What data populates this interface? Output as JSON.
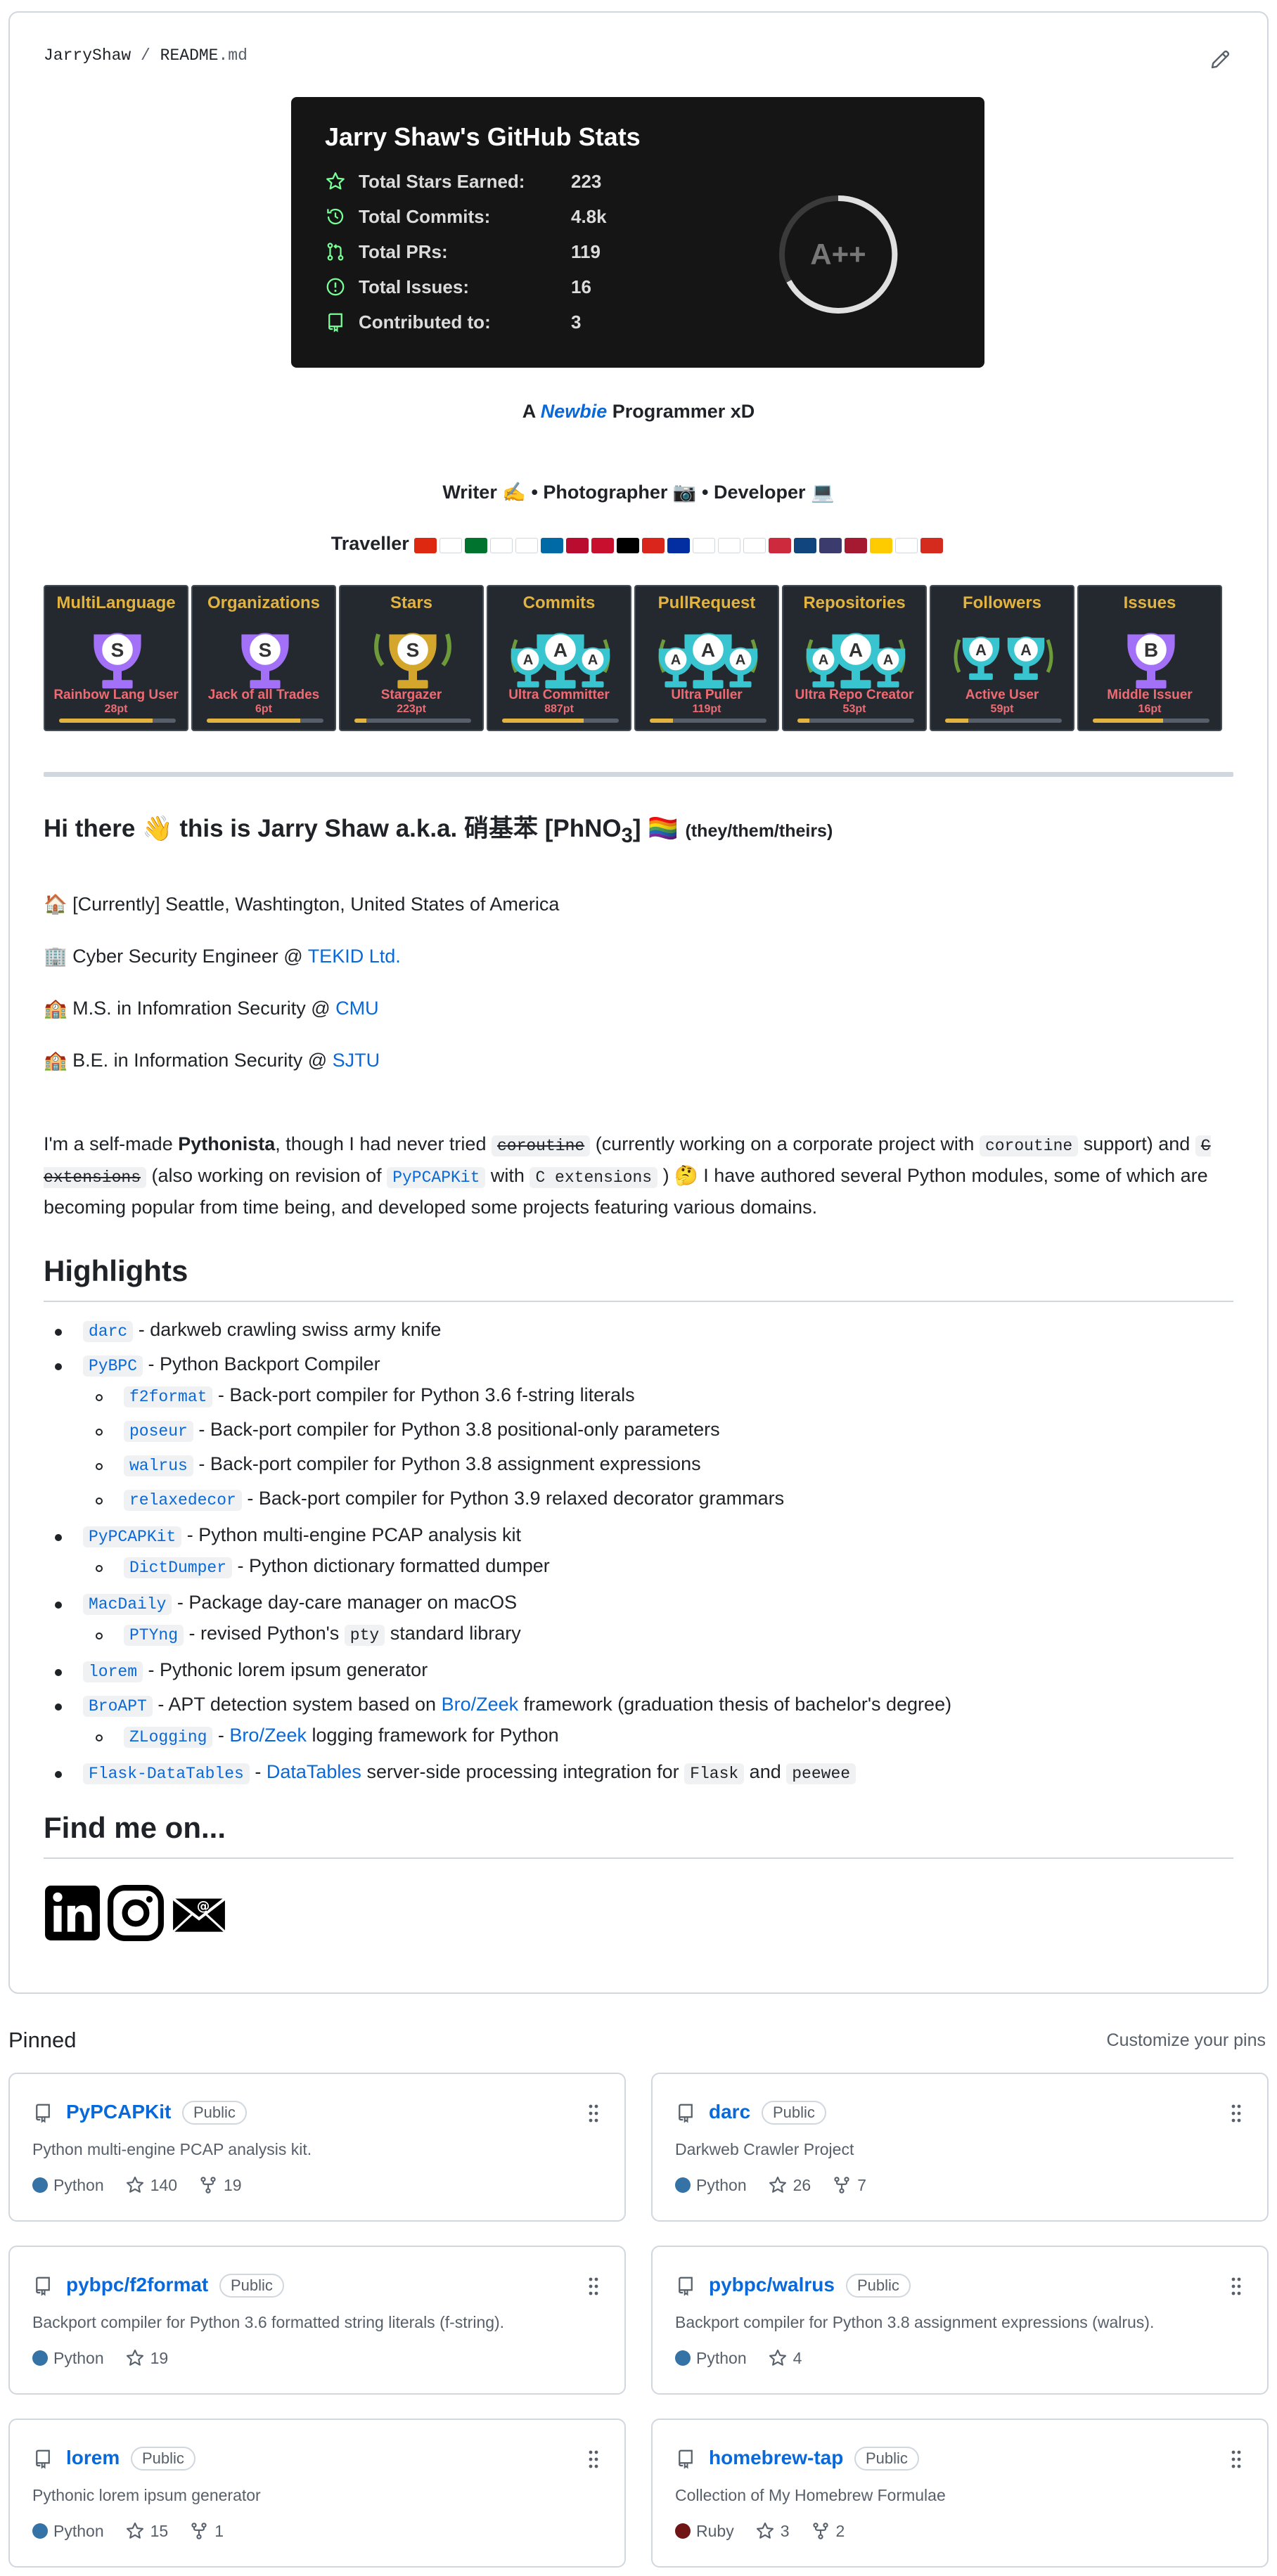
{
  "readme": {
    "owner": "JarryShaw",
    "sep": " / ",
    "file_base": "README",
    "file_ext": ".md"
  },
  "stats_card": {
    "title": "Jarry Shaw's GitHub Stats",
    "rows": [
      {
        "label": "Total Stars Earned:",
        "value": "223",
        "icon": "star-icon"
      },
      {
        "label": "Total Commits:",
        "value": "4.8k",
        "icon": "history-icon"
      },
      {
        "label": "Total PRs:",
        "value": "119",
        "icon": "pull-request-icon"
      },
      {
        "label": "Total Issues:",
        "value": "16",
        "icon": "issue-icon"
      },
      {
        "label": "Contributed to:",
        "value": "3",
        "icon": "repo-icon"
      }
    ],
    "grade": "A++",
    "accent": "#79ff97"
  },
  "tagline": {
    "prefix": "A ",
    "emph": "Newbie",
    "suffix": " Programmer xD"
  },
  "roles": "Writer ✍️ • Photographer 📷 • Developer 💻",
  "traveller": {
    "label": "Traveller",
    "flags": [
      "#de2910",
      "#ffffff",
      "#00732f",
      "#ffffff",
      "#ffffff",
      "#006aa7",
      "#ba0c2f",
      "#c8102e",
      "#000000",
      "#da251d",
      "#032ea1",
      "#ffffff",
      "#ffffff",
      "#ffffff",
      "#cd2a3e",
      "#11457e",
      "#3c3b6e",
      "#a51931",
      "#fecb00",
      "#ffffff",
      "#d52b1e"
    ]
  },
  "trophies": [
    {
      "category": "MultiLanguage",
      "rank": "S",
      "title": "Rainbow Lang User",
      "points": "28pt",
      "progress": 0.8,
      "color": "#a371f7"
    },
    {
      "category": "Organizations",
      "rank": "S",
      "title": "Jack of all Trades",
      "points": "6pt",
      "progress": 0.8,
      "color": "#a371f7"
    },
    {
      "category": "Stars",
      "rank": "S",
      "title": "Stargazer",
      "points": "223pt",
      "progress": 0.1,
      "color": "#d4a72c"
    },
    {
      "category": "Commits",
      "rank": "AAA",
      "title": "Ultra Committer",
      "points": "887pt",
      "progress": 0.7,
      "color": "#39c5cf"
    },
    {
      "category": "PullRequest",
      "rank": "AAA",
      "title": "Ultra Puller",
      "points": "119pt",
      "progress": 0.2,
      "color": "#39c5cf"
    },
    {
      "category": "Repositories",
      "rank": "AAA",
      "title": "Ultra Repo Creator",
      "points": "53pt",
      "progress": 0.1,
      "color": "#39c5cf"
    },
    {
      "category": "Followers",
      "rank": "AA",
      "title": "Active User",
      "points": "59pt",
      "progress": 0.2,
      "color": "#39c5cf"
    },
    {
      "category": "Issues",
      "rank": "B",
      "title": "Middle Issuer",
      "points": "16pt",
      "progress": 0.6,
      "color": "#a371f7"
    }
  ],
  "intro": {
    "heading": "Hi there 👋 this is Jarry Shaw a.k.a. 硝基苯 [PhNO",
    "sub": "3",
    "heading_tail": "] 🏳️‍🌈",
    "pronouns": "(they/them/theirs)"
  },
  "facts": [
    {
      "text": "🏠 [Currently] Seattle, Washtington, United States of America",
      "link": ""
    },
    {
      "text": "🏢 Cyber Security Engineer @ ",
      "link": "TEKID Ltd."
    },
    {
      "text": "🏫 M.S. in Infomration Security @ ",
      "link": "CMU"
    },
    {
      "text": "🏫 B.E. in Information Security @ ",
      "link": "SJTU"
    }
  ],
  "about": {
    "p1": "I'm a self-made ",
    "pythonista": "Pythonista",
    "p2": ", though I had never tried ",
    "c1": "coroutine",
    "p3": " (currently working on a corporate project with ",
    "c2": "coroutine",
    "p4": " support) and ",
    "c3": "C extensions",
    "p5": " (also working on revision of ",
    "c4": "PyPCAPKit",
    "p6": " with ",
    "c5": "C extensions",
    "p7": " ) 🤔 I have authored several Python modules, some of which are becoming popular from time being, and developed some projects featuring various domains."
  },
  "highlights": {
    "heading": "Highlights",
    "items": [
      {
        "code": "darc",
        "text": " - darkweb crawling swiss army knife",
        "level": 0
      },
      {
        "code": "PyBPC",
        "text": " - Python Backport Compiler",
        "level": 0
      },
      {
        "code": "f2format",
        "text": " - Back-port compiler for Python 3.6 f-string literals",
        "level": 1
      },
      {
        "code": "poseur",
        "text": " - Back-port compiler for Python 3.8 positional-only parameters",
        "level": 1
      },
      {
        "code": "walrus",
        "text": " - Back-port compiler for Python 3.8 assignment expressions",
        "level": 1
      },
      {
        "code": "relaxedecor",
        "text": " - Back-port compiler for Python 3.9 relaxed decorator grammars",
        "level": 1
      },
      {
        "code": "PyPCAPKit",
        "text": " - Python multi-engine PCAP analysis kit",
        "level": 0
      },
      {
        "code": "DictDumper",
        "text": " - Python dictionary formatted dumper",
        "level": 1
      },
      {
        "code": "MacDaily",
        "text": " - Package day-care manager on macOS",
        "level": 0
      },
      {
        "code": "PTYng",
        "text": " - revised Python's ",
        "code2": "pty",
        "tail": " standard library",
        "level": 1
      },
      {
        "code": "lorem",
        "text": " - Pythonic lorem ipsum generator",
        "level": 0
      },
      {
        "code": "BroAPT",
        "text": " - APT detection system based on ",
        "link": "Bro/Zeek",
        "tail": " framework (graduation thesis of bachelor's degree)",
        "level": 0
      },
      {
        "code": "ZLogging",
        "text": " - ",
        "link": "Bro/Zeek",
        "tail": " logging framework for Python",
        "level": 1
      },
      {
        "code": "Flask-DataTables",
        "text": " - ",
        "link": "DataTables",
        "tail": " server-side processing integration for ",
        "code2": "Flask",
        "tail2": " and ",
        "code3": "peewee",
        "level": 0
      }
    ]
  },
  "find_me": {
    "heading": "Find me on...",
    "icons": [
      "linkedin-icon",
      "instagram-icon",
      "email-icon"
    ]
  },
  "pinned": {
    "heading": "Pinned",
    "customize": "Customize your pins",
    "badge": "Public",
    "repos": [
      {
        "name": "PyPCAPKit",
        "desc": "Python multi-engine PCAP analysis kit.",
        "lang": "Python",
        "lang_color": "#3572A5",
        "stars": "140",
        "forks": "19"
      },
      {
        "name": "darc",
        "desc": "Darkweb Crawler Project",
        "lang": "Python",
        "lang_color": "#3572A5",
        "stars": "26",
        "forks": "7"
      },
      {
        "name": "pybpc/f2format",
        "desc": "Backport compiler for Python 3.6 formatted string literals (f-string).",
        "lang": "Python",
        "lang_color": "#3572A5",
        "stars": "19",
        "forks": ""
      },
      {
        "name": "pybpc/walrus",
        "desc": "Backport compiler for Python 3.8 assignment expressions (walrus).",
        "lang": "Python",
        "lang_color": "#3572A5",
        "stars": "4",
        "forks": ""
      },
      {
        "name": "lorem",
        "desc": "Pythonic lorem ipsum generator",
        "lang": "Python",
        "lang_color": "#3572A5",
        "stars": "15",
        "forks": "1"
      },
      {
        "name": "homebrew-tap",
        "desc": "Collection of My Homebrew Formulae",
        "lang": "Ruby",
        "lang_color": "#701516",
        "stars": "3",
        "forks": "2"
      }
    ]
  }
}
